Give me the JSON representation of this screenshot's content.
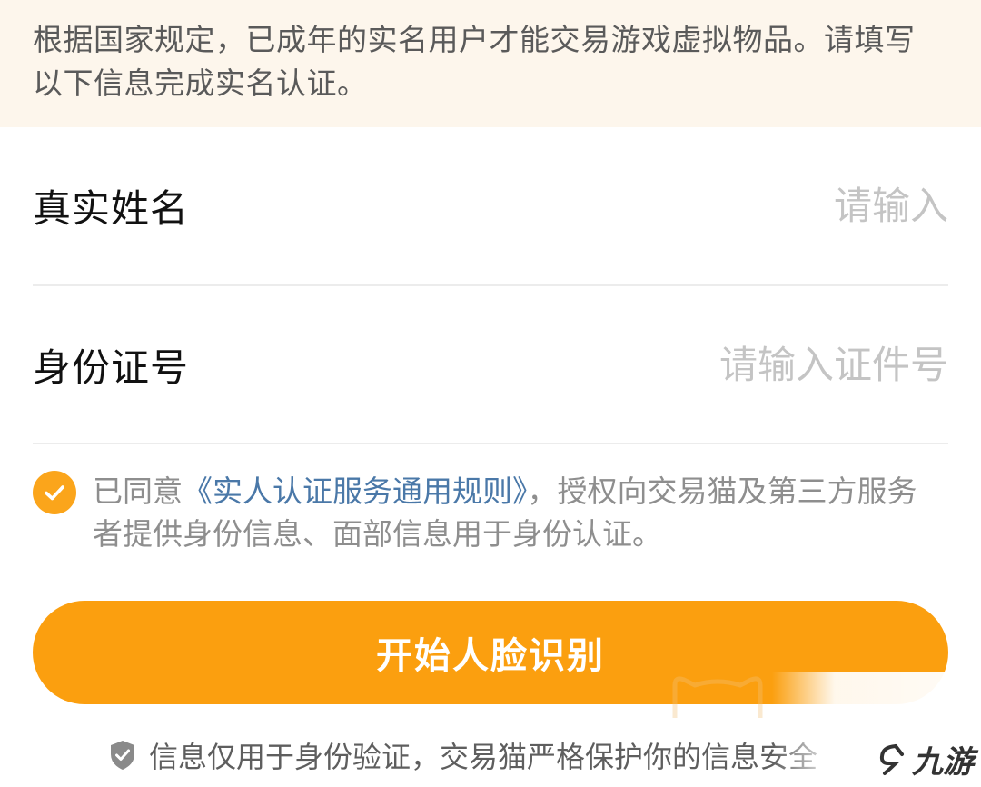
{
  "notice": {
    "line1": "根据国家规定，已成年的实名用户才能交易游戏虚拟物品。请填写",
    "line2": "以下信息完成实名认证。"
  },
  "form": {
    "name_label": "真实姓名",
    "name_placeholder": "请输入",
    "id_label": "身份证号",
    "id_placeholder": "请输入证件号"
  },
  "agreement": {
    "prefix": "已同意",
    "link": "《实人认证服务通用规则》",
    "suffix": "，授权向交易猫及第三方服务者提供身份信息、面部信息用于身份认证。",
    "checked": true
  },
  "primary_button": {
    "label": "开始人脸识别"
  },
  "privacy_note": {
    "text": "信息仅用于身份验证，交易猫严格保护你的信息安全"
  },
  "watermark": {
    "text": "九游"
  },
  "colors": {
    "accent": "#fb9f0f",
    "link": "#4a78a8",
    "notice_bg": "#fdf6ec"
  }
}
